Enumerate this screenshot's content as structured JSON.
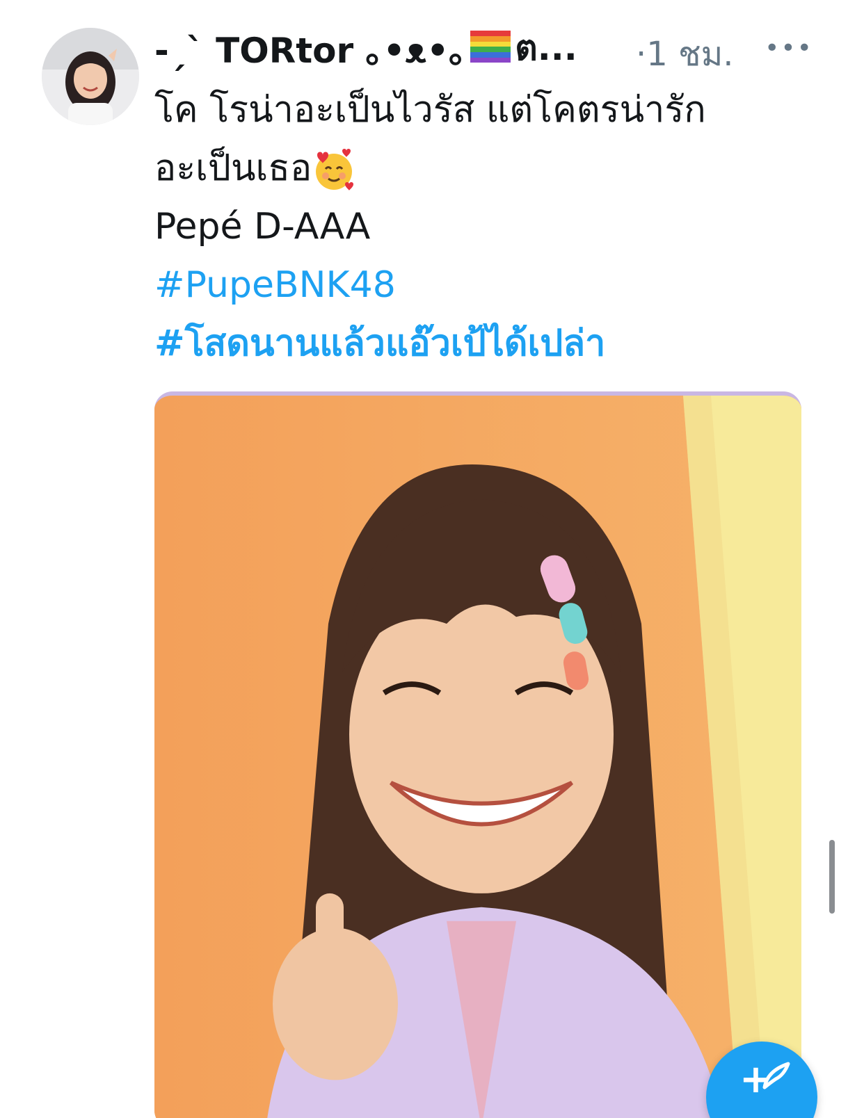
{
  "tweet": {
    "display_name": "-ˏˋ TORtor ｡•ᴥ•｡",
    "display_name_tail": "ต...",
    "time": "·1 ชม.",
    "text_lines": [
      "โค โรน่าอะเป็นไวรัส แต่โคตรน่ารัก",
      "อะเป็นเธอ",
      "Pepé D-AAA"
    ],
    "hashtags": [
      "#PupeBNK48",
      "#โสดนานแล้วแอ๊วเป้ได้เปล่า"
    ]
  },
  "icons": {
    "more": "more-horizontal-icon",
    "flag": "rainbow-flag-icon",
    "emoji": "smiling-face-with-hearts-icon",
    "compose": "compose-tweet-icon"
  },
  "colors": {
    "accent": "#1da1f2",
    "muted": "#657786",
    "text": "#14171a"
  }
}
